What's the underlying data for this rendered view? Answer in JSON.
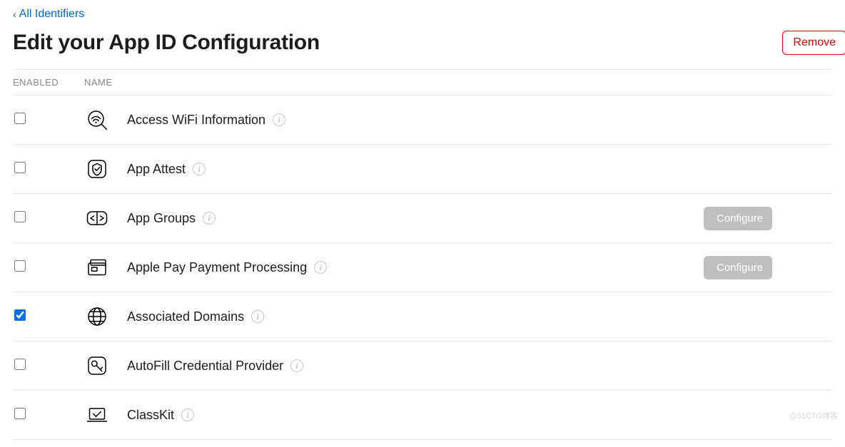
{
  "back_link": "All Identifiers",
  "page_title": "Edit your App ID Configuration",
  "remove_label": "Remove",
  "columns": {
    "enabled": "ENABLED",
    "name": "NAME"
  },
  "configure_label": "Configure",
  "capabilities": [
    {
      "name": "Access WiFi Information",
      "enabled": false,
      "configurable": false,
      "icon": "wifi-search"
    },
    {
      "name": "App Attest",
      "enabled": false,
      "configurable": false,
      "icon": "attest"
    },
    {
      "name": "App Groups",
      "enabled": false,
      "configurable": true,
      "icon": "app-groups"
    },
    {
      "name": "Apple Pay Payment Processing",
      "enabled": false,
      "configurable": true,
      "icon": "apple-pay"
    },
    {
      "name": "Associated Domains",
      "enabled": true,
      "configurable": false,
      "icon": "globe"
    },
    {
      "name": "AutoFill Credential Provider",
      "enabled": false,
      "configurable": false,
      "icon": "key"
    },
    {
      "name": "ClassKit",
      "enabled": false,
      "configurable": false,
      "icon": "classkit"
    }
  ],
  "watermark": "@51CTO博客"
}
